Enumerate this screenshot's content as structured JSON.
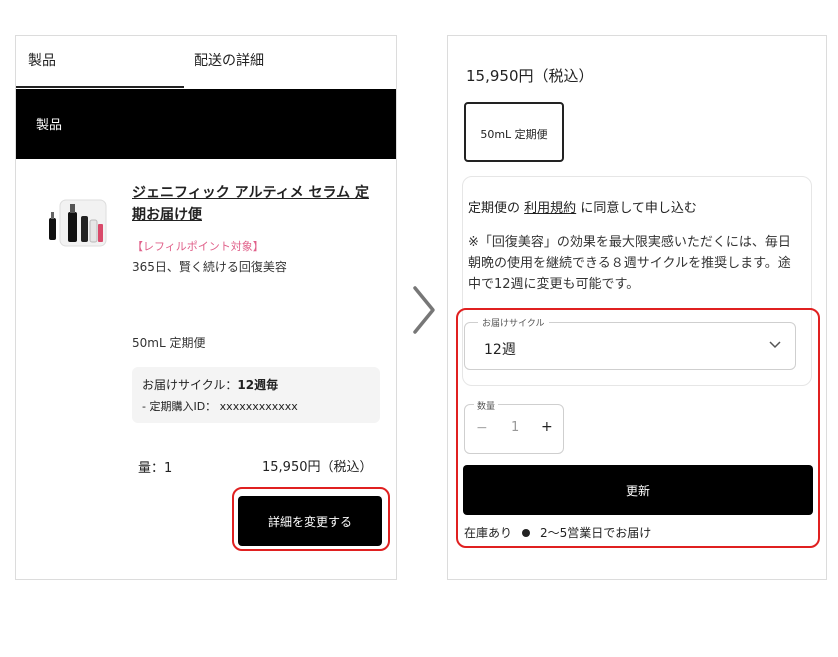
{
  "left_panel": {
    "tabs": [
      {
        "label": "製品"
      },
      {
        "label": "配送の詳細"
      }
    ],
    "section_header": "製品",
    "product": {
      "title": "ジェニフィック アルティメ セラム 定期お届け便",
      "badge": "【レフィルポイント対象】",
      "tagline": "365日、賢く続ける回復美容",
      "variant": "50mL 定期便",
      "cycle_label": "お届けサイクル：",
      "cycle_value": "12週毎",
      "subscription_id": "- 定期購入ID： xxxxxxxxxxxx",
      "quantity": "量：1",
      "price": "15,950円（税込）"
    },
    "detail_button": "詳細を変更する"
  },
  "right_panel": {
    "price": "15,950円（税込）",
    "variant_chip": "50mL 定期便",
    "agree_prefix": "定期便の",
    "agree_link": "利用規約",
    "agree_suffix": "に同意して申し込む",
    "note": "※「回復美容」の効果を最大限実感いただくには、毎日朝晩の使用を継続できる８週サイクルを推奨します。途中で12週に変更も可能です。",
    "cycle_select": {
      "label": "お届けサイクル",
      "value": "12週"
    },
    "quantity": {
      "label": "数量",
      "minus": "−",
      "value": "1",
      "plus": "+"
    },
    "update_button": "更新",
    "stock": {
      "label": "在庫あり",
      "eta": "2〜5営業日でお届け"
    }
  },
  "icons": {
    "arrow": "chevron-right-icon",
    "select": "chevron-down-icon",
    "stock": "dot-icon"
  },
  "colors": {
    "highlight": "#e02020",
    "badge": "#e0608a",
    "button": "#000000"
  }
}
